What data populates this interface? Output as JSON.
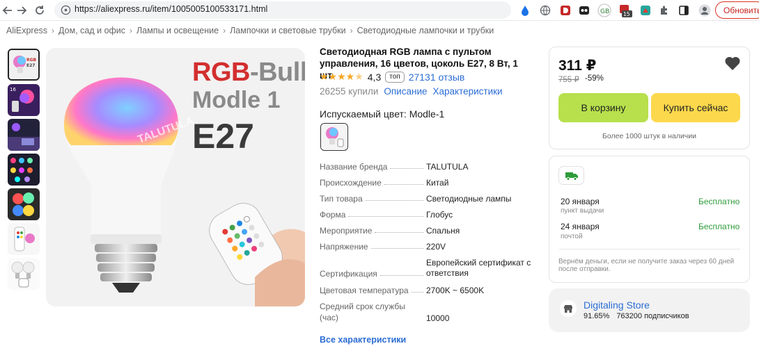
{
  "browser": {
    "url": "https://aliexpress.ru/item/1005005100533171.html",
    "update_label": "Обновить",
    "ext_badge_count": "15"
  },
  "breadcrumb": [
    "AliExpress",
    "Дом, сад и офис",
    "Лампы и освещение",
    "Лампочки и световые трубки",
    "Светодиодные лампочки и трубки"
  ],
  "product_image": {
    "rgb_text_red": "RGB",
    "rgb_text_gray": "-Bulb",
    "modle_text": "Modle 1",
    "e27_text": "E27",
    "watermark": "TALUTULA"
  },
  "product": {
    "title": "Светодиодная RGB лампа с пультом управления, 16 цветов, цоколь E27, 8 Вт, 1 шт",
    "rating": "4,3",
    "top_badge": "топ",
    "reviews": "27131 отзыв",
    "sold": "26255 купили",
    "description_link": "Описание",
    "specs_link": "Характеристики",
    "color_label": "Испускаемый цвет: Modle-1"
  },
  "specs": [
    {
      "name": "Название бренда",
      "value": "TALUTULA"
    },
    {
      "name": "Происхождение",
      "value": "Китай"
    },
    {
      "name": "Тип товара",
      "value": "Светодиодные лампы"
    },
    {
      "name": "Форма",
      "value": "Глобус"
    },
    {
      "name": "Мероприятие",
      "value": "Спальня"
    },
    {
      "name": "Напряжение",
      "value": "220V"
    },
    {
      "name": "Сертификация",
      "value": "Европейский сертификат с ответствия"
    },
    {
      "name": "Цветовая температура",
      "value": "2700K ~ 6500K"
    },
    {
      "name": "Средний срок службы (час)",
      "value": "10000"
    }
  ],
  "all_specs_link": "Все характеристики",
  "buy_box": {
    "price": "311 ₽",
    "old_price": "755 ₽",
    "discount": "-59%",
    "cart_button": "В корзину",
    "buy_now_button": "Купить сейчас",
    "stock": "Более 1000 штук в наличии"
  },
  "delivery": {
    "options": [
      {
        "date": "20 января",
        "method": "пункт выдачи",
        "price": "Бесплатно"
      },
      {
        "date": "24 января",
        "method": "почтой",
        "price": "Бесплатно"
      }
    ],
    "refund_note": "Вернём деньги, если не получите заказ через 60 дней после отправки."
  },
  "store": {
    "name": "Digitaling Store",
    "rating": "91.65%",
    "subscribers": "763200 подписчиков"
  },
  "colors": {
    "accent_blue": "#2b6dd4",
    "cart_green": "#b7e04c",
    "buy_yellow": "#fcd84c",
    "free_green": "#2e9c3a",
    "star_orange": "#f5a623"
  }
}
